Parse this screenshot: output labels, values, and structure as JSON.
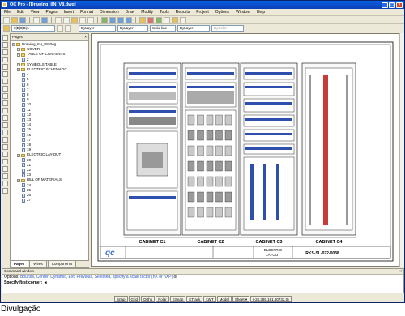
{
  "window": {
    "title": "QC Pro - [Drawing_IIN_V8.dwg]"
  },
  "menu": [
    "File",
    "Edit",
    "View",
    "Pages",
    "Insert",
    "Format",
    "Dimension",
    "Draw",
    "Modify",
    "Tools",
    "Reports",
    "Project",
    "Options",
    "Window",
    "Help"
  ],
  "layerbar": {
    "layer_value": "0|E|0|B|A",
    "bylayer_1": "ByLayer",
    "bylayer_2": "ByLayer",
    "linetype": "Solid line",
    "bylayer_3": "ByLayer",
    "bycolor": "ByColor"
  },
  "pages_panel": {
    "title": "Pages",
    "tree": [
      {
        "type": "file",
        "label": "Drawing_IIN_V8.dwg",
        "indent": 0
      },
      {
        "type": "folder",
        "label": "COVER",
        "indent": 1
      },
      {
        "type": "folder",
        "label": "TABLE OF CONTENTS",
        "indent": 1
      },
      {
        "type": "page",
        "label": "2",
        "indent": 2
      },
      {
        "type": "folder",
        "label": "SYMBOLS TABLE",
        "indent": 1
      },
      {
        "type": "folder",
        "label": "ELECTRIC SCHEMATIC",
        "indent": 1
      },
      {
        "type": "page",
        "label": "4",
        "indent": 2
      },
      {
        "type": "page",
        "label": "5",
        "indent": 2
      },
      {
        "type": "page",
        "label": "6",
        "indent": 2
      },
      {
        "type": "page",
        "label": "7",
        "indent": 2
      },
      {
        "type": "page",
        "label": "8",
        "indent": 2
      },
      {
        "type": "page",
        "label": "9",
        "indent": 2
      },
      {
        "type": "page",
        "label": "10",
        "indent": 2
      },
      {
        "type": "page",
        "label": "11",
        "indent": 2
      },
      {
        "type": "page",
        "label": "12",
        "indent": 2
      },
      {
        "type": "page",
        "label": "13",
        "indent": 2
      },
      {
        "type": "page",
        "label": "14",
        "indent": 2
      },
      {
        "type": "page",
        "label": "15",
        "indent": 2
      },
      {
        "type": "page",
        "label": "16",
        "indent": 2
      },
      {
        "type": "page",
        "label": "17",
        "indent": 2
      },
      {
        "type": "page",
        "label": "18",
        "indent": 2
      },
      {
        "type": "page",
        "label": "19",
        "indent": 2
      },
      {
        "type": "folder",
        "label": "ELECTRIC LAY-OUT",
        "indent": 1
      },
      {
        "type": "page",
        "label": "20",
        "indent": 2
      },
      {
        "type": "page",
        "label": "21",
        "indent": 2
      },
      {
        "type": "page",
        "label": "22",
        "indent": 2
      },
      {
        "type": "page",
        "label": "23",
        "indent": 2
      },
      {
        "type": "folder",
        "label": "BILL OF MATERIALS",
        "indent": 1
      },
      {
        "type": "page",
        "label": "24",
        "indent": 2
      },
      {
        "type": "page",
        "label": "25",
        "indent": 2
      },
      {
        "type": "page",
        "label": "26",
        "indent": 2
      },
      {
        "type": "page",
        "label": "27",
        "indent": 2
      }
    ],
    "tabs": [
      "Pages",
      "Wires",
      "Components"
    ]
  },
  "drawing": {
    "cabinets": [
      "CABINET C1",
      "CABINET C2",
      "CABINET C3",
      "CABINET C4"
    ],
    "titleblock": {
      "title_line1": "ELECTRIC",
      "title_line2": "LAYOUT",
      "drawing_no": "RKS-SL-072-0038"
    }
  },
  "command_window": {
    "title": "Command window",
    "prompt_prefix": "Options: ",
    "options": "Bounds, Center, Dynamic, Ext, Previous, Selected, specify a scale factor (nX or nXP)",
    "prompt_suffix": " or",
    "current": "Specify first corner: ◄"
  },
  "statusbar": [
    "Snap",
    "Grid",
    "Ortho",
    "Polar",
    "ESnap",
    "ETrack",
    "LWT",
    "Model",
    "Sheet ▾",
    "(-26.389,181.80732,0)"
  ],
  "caption": "Divulgação"
}
